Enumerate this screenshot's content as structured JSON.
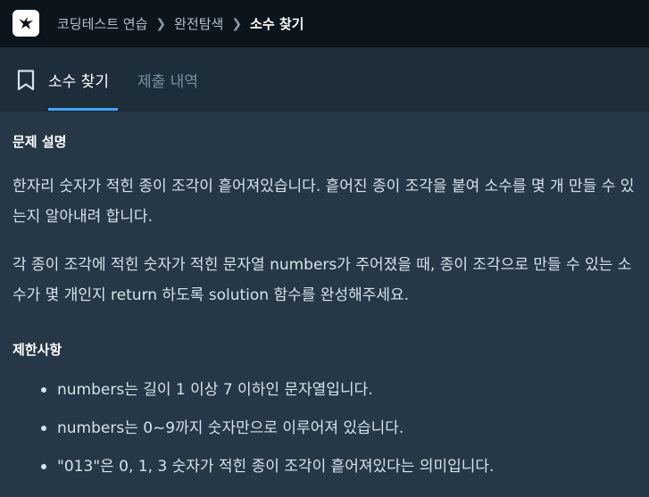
{
  "header": {
    "breadcrumbs": [
      "코딩테스트 연습",
      "완전탐색",
      "소수 찾기"
    ]
  },
  "tabs": [
    {
      "label": "소수 찾기",
      "active": true
    },
    {
      "label": "제출 내역",
      "active": false
    }
  ],
  "problem": {
    "heading": "문제 설명",
    "paragraph1": "한자리 숫자가 적힌 종이 조각이 흩어져있습니다. 흩어진 종이 조각을 붙여 소수를 몇 개 만들 수 있는지 알아내려 합니다.",
    "paragraph2": "각 종이 조각에 적힌 숫자가 적힌 문자열 numbers가 주어졌을 때, 종이 조각으로 만들 수 있는 소수가 몇 개인지 return 하도록 solution 함수를 완성해주세요."
  },
  "limits": {
    "heading": "제한사항",
    "items": [
      "numbers는 길이 1 이상 7 이하인 문자열입니다.",
      "numbers는 0~9까지 숫자만으로 이루어져 있습니다.",
      "\"013\"은 0, 1, 3 숫자가 적힌 종이 조각이 흩어져있다는 의미입니다."
    ]
  },
  "icons": {
    "logo": "programmers-bird-logo-icon",
    "separator": "chevron-right-icon",
    "bookmark": "bookmark-icon"
  },
  "colors": {
    "topbar": "#0c151c",
    "tabbar": "#1e2d3a",
    "background": "#263747",
    "accent": "#44a4fc"
  }
}
